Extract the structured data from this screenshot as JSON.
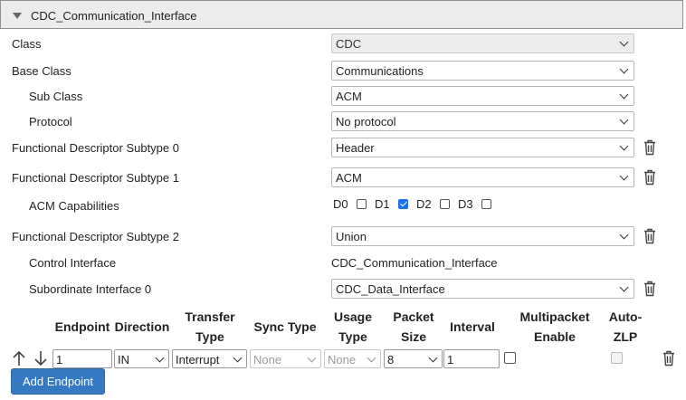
{
  "section": {
    "title": "CDC_Communication_Interface"
  },
  "fields": {
    "class_label": "Class",
    "class_value": "CDC",
    "base_class_label": "Base Class",
    "base_class_value": "Communications",
    "sub_class_label": "Sub Class",
    "sub_class_value": "ACM",
    "protocol_label": "Protocol",
    "protocol_value": "No protocol",
    "fds0_label": "Functional Descriptor Subtype 0",
    "fds0_value": "Header",
    "fds1_label": "Functional Descriptor Subtype 1",
    "fds1_value": "ACM",
    "acm_cap_label": "ACM Capabilities",
    "acm_caps": [
      {
        "label": "D0",
        "checked": false
      },
      {
        "label": "D1",
        "checked": true
      },
      {
        "label": "D2",
        "checked": false
      },
      {
        "label": "D3",
        "checked": false
      }
    ],
    "fds2_label": "Functional Descriptor Subtype 2",
    "fds2_value": "Union",
    "control_interface_label": "Control Interface",
    "control_interface_value": "CDC_Communication_Interface",
    "subordinate_label": "Subordinate Interface 0",
    "subordinate_value": "CDC_Data_Interface"
  },
  "endpoints": {
    "headers": {
      "endpoint": "Endpoint",
      "direction": "Direction",
      "transfer_type": "Transfer Type",
      "sync_type": "Sync Type",
      "usage_type": "Usage Type",
      "packet_size": "Packet Size",
      "interval": "Interval",
      "multipacket": "Multipacket Enable",
      "auto_zlp": "Auto-ZLP"
    },
    "row": {
      "endpoint": "1",
      "direction": "IN",
      "transfer_type": "Interrupt",
      "sync_type": "None",
      "usage_type": "None",
      "packet_size": "8",
      "interval": "1",
      "multipacket_enable": false,
      "auto_zlp": false
    },
    "add_button": "Add Endpoint"
  },
  "icons": [
    "collapse-triangle-icon",
    "chevron-down-icon",
    "trash-icon",
    "arrow-up-icon",
    "arrow-down-icon"
  ],
  "colors": {
    "primary_button": "#3579c2",
    "checkbox_checked": "#1a73e8",
    "header_bg": "#ececec"
  }
}
